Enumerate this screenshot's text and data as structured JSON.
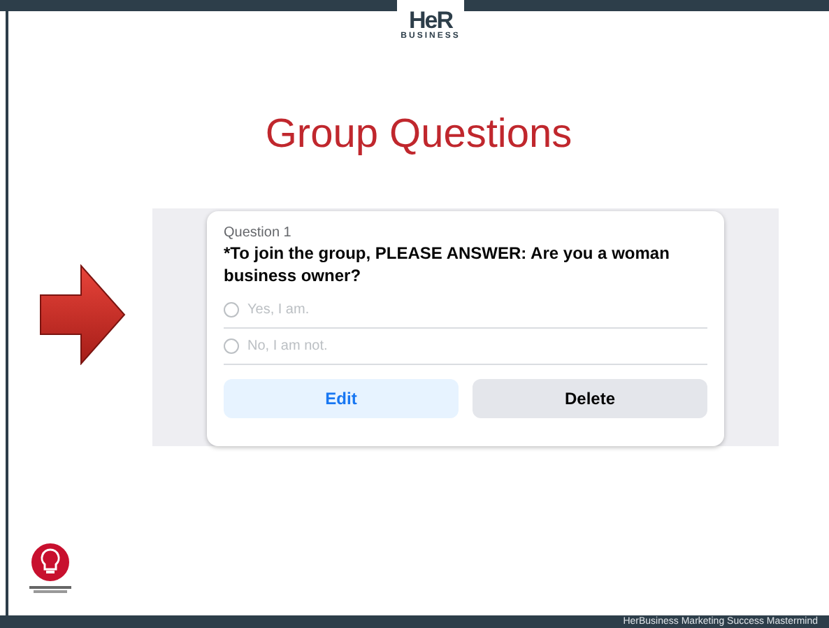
{
  "logo": {
    "mark": "HeR",
    "subtitle": "BUSINESS"
  },
  "title": "Group Questions",
  "question": {
    "number": "Question 1",
    "text": "*To join the group, PLEASE ANSWER: Are you a woman business owner?",
    "options": [
      {
        "label": "Yes, I am.",
        "selected": false
      },
      {
        "label": "No, I am not.",
        "selected": false
      }
    ],
    "buttons": [
      {
        "label": "Edit",
        "kind": "primary"
      },
      {
        "label": "Delete",
        "kind": "secondary"
      }
    ]
  },
  "footer": "HerBusiness Marketing Success Mastermind"
}
